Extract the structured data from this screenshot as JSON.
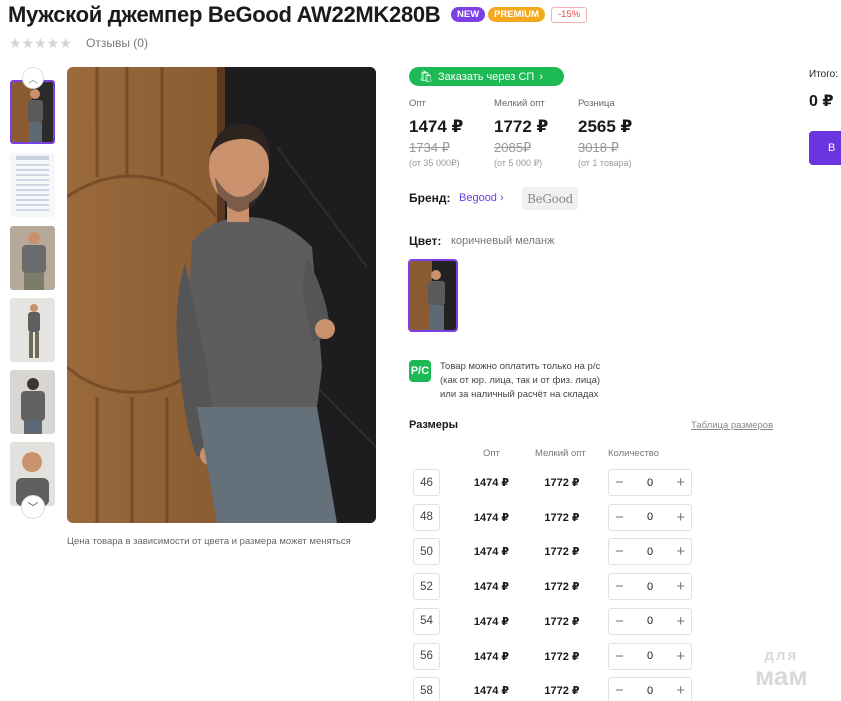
{
  "product": {
    "title": "Мужской джемпер BeGood AW22MK280B",
    "badges": {
      "new": "NEW",
      "premium": "PREMIUM",
      "discount": "-15%"
    },
    "stars": "★★★★★",
    "reviews": "Отзывы (0)",
    "price_note": "Цена товара в зависимости от цвета и размера может меняться"
  },
  "gallery": {
    "up_icon": "chevron-up-icon",
    "down_icon": "chevron-down-icon"
  },
  "sp_button": {
    "label": "Заказать через СП",
    "icon": "cart-icon"
  },
  "prices": [
    {
      "label": "Опт",
      "value": "1474 ₽",
      "old": "1734 ₽",
      "min": "(от 35 000₽)"
    },
    {
      "label": "Мелкий опт",
      "value": "1772 ₽",
      "old": "2085₽",
      "min": "(от 5 000 ₽)"
    },
    {
      "label": "Розница",
      "value": "2565 ₽",
      "old": "3018 ₽",
      "min": "(от 1 товара)"
    }
  ],
  "brand": {
    "label": "Бренд:",
    "name": "Begood",
    "logo_text": "BeGood"
  },
  "color": {
    "label": "Цвет:",
    "value": "коричневый меланж"
  },
  "payment": {
    "icon_text": "P/C",
    "line1": "Товар можно оплатить только на р/с",
    "line2": "(как от юр. лица, так и от физ. лица)",
    "line3": "или за наличный расчёт на складах"
  },
  "sizes": {
    "title": "Размеры",
    "table_link": "Таблица размеров",
    "headers": {
      "opt": "Опт",
      "small_opt": "Мелкий опт",
      "qty": "Количество"
    },
    "rows": [
      {
        "size": "46",
        "opt": "1474 ₽",
        "small_opt": "1772 ₽",
        "qty": "0"
      },
      {
        "size": "48",
        "opt": "1474 ₽",
        "small_opt": "1772 ₽",
        "qty": "0"
      },
      {
        "size": "50",
        "opt": "1474 ₽",
        "small_opt": "1772 ₽",
        "qty": "0"
      },
      {
        "size": "52",
        "opt": "1474 ₽",
        "small_opt": "1772 ₽",
        "qty": "0"
      },
      {
        "size": "54",
        "opt": "1474 ₽",
        "small_opt": "1772 ₽",
        "qty": "0"
      },
      {
        "size": "56",
        "opt": "1474 ₽",
        "small_opt": "1772 ₽",
        "qty": "0"
      },
      {
        "size": "58",
        "opt": "1474 ₽",
        "small_opt": "1772 ₽",
        "qty": "0"
      }
    ]
  },
  "summary": {
    "total_label": "Итого:",
    "total_value": "0 ₽",
    "buy_label": "В"
  },
  "watermark": {
    "top": "для",
    "bottom": "мам"
  },
  "colors": {
    "accent": "#7b3fe4",
    "green": "#1db954",
    "premium": "#f4a81d"
  }
}
